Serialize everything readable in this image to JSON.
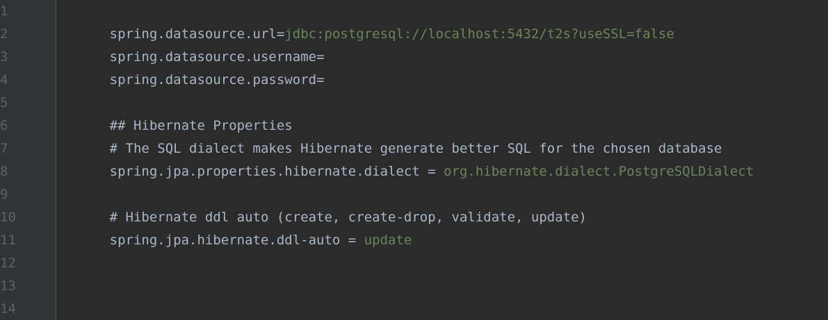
{
  "editor": {
    "line_numbers": [
      "1",
      "2",
      "3",
      "4",
      "5",
      "6",
      "7",
      "8",
      "9",
      "10",
      "11",
      "12",
      "13",
      "14"
    ],
    "lines": [
      {
        "key": "spring.datasource.url",
        "sep": "=",
        "value": "jdbc:postgresql://localhost:5432/t2s?useSSL=false"
      },
      {
        "key": "spring.datasource.username",
        "sep": "=",
        "value": ""
      },
      {
        "key": "spring.datasource.password",
        "sep": "=",
        "value": ""
      },
      {
        "comment": ""
      },
      {
        "comment": "## Hibernate Properties"
      },
      {
        "comment": "# The SQL dialect makes Hibernate generate better SQL for the chosen database"
      },
      {
        "key": "spring.jpa.properties.hibernate.dialect",
        "sep": " = ",
        "value": "org.hibernate.dialect.PostgreSQLDialect"
      },
      {
        "comment": ""
      },
      {
        "comment": "# Hibernate ddl auto (create, create-drop, validate, update)"
      },
      {
        "key": "spring.jpa.hibernate.ddl-auto",
        "sep": " = ",
        "value": "update"
      },
      {
        "comment": ""
      },
      {
        "comment": ""
      },
      {
        "comment": ""
      },
      {
        "comment": ""
      }
    ]
  },
  "colors": {
    "background": "#2b2b2b",
    "gutter": "#313335",
    "line_number": "#606366",
    "key": "#a9b7c6",
    "value": "#6a8759"
  }
}
